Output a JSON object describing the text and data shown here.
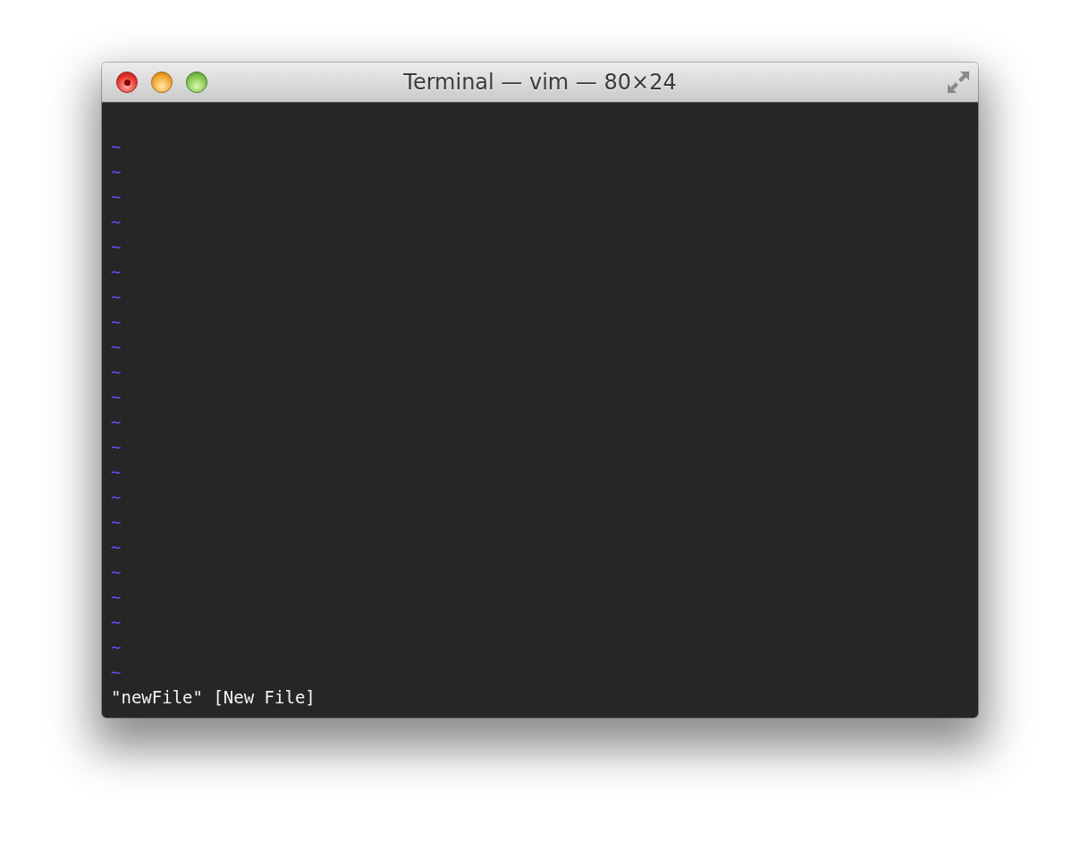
{
  "window": {
    "title": "Terminal — vim — 80×24"
  },
  "buffer": {
    "empty_lines": [
      "~",
      "~",
      "~",
      "~",
      "~",
      "~",
      "~",
      "~",
      "~",
      "~",
      "~",
      "~",
      "~",
      "~",
      "~",
      "~",
      "~",
      "~",
      "~",
      "~",
      "~",
      "~"
    ]
  },
  "message": "\"newFile\" [New File]"
}
